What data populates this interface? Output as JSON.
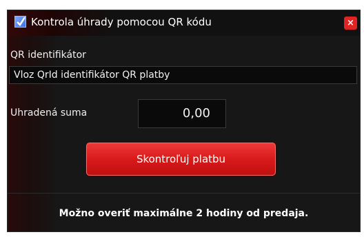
{
  "window": {
    "title": "Kontrola úhrady pomocou QR kódu",
    "close_glyph": "×"
  },
  "qr": {
    "label": "QR identifikátor",
    "value": "Vloz QrId identifikátor QR platby"
  },
  "sum": {
    "label": "Uhradená suma",
    "value": "0,00"
  },
  "actions": {
    "check_label": "Skontroľuj platbu"
  },
  "footer": {
    "note": "Možno overiť maximálne 2 hodiny od predaja."
  },
  "colors": {
    "accent": "#d81a1a",
    "background": "#171717",
    "close": "#e02424"
  },
  "icons": {
    "app": "checkbox-icon",
    "close": "close-icon"
  }
}
